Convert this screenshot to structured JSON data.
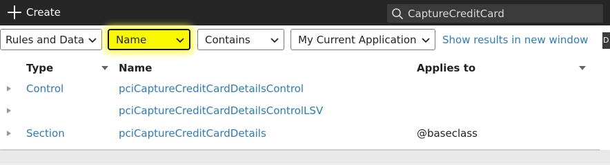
{
  "topbar": {
    "create_label": "Create",
    "search_value": "CaptureCreditCard"
  },
  "filters": {
    "category": "Rules and Data",
    "field": "Name",
    "operator": "Contains",
    "scope": "My Current Application",
    "show_results_link": "Show results in new window",
    "highlight_color": "#f8f800"
  },
  "right_edge_label": "D",
  "table": {
    "columns": {
      "type": "Type",
      "name": "Name",
      "applies_to": "Applies to"
    },
    "rows": [
      {
        "type": "Control",
        "name": "pciCaptureCreditCardDetailsControl",
        "applies_to": ""
      },
      {
        "type": "",
        "name": "pciCaptureCreditCardDetailsControlLSV",
        "applies_to": ""
      },
      {
        "type": "Section",
        "name": "pciCaptureCreditCardDetails",
        "applies_to": "@baseclass"
      }
    ]
  },
  "colors": {
    "link": "#2b7bbf",
    "topbar": "#262626"
  }
}
